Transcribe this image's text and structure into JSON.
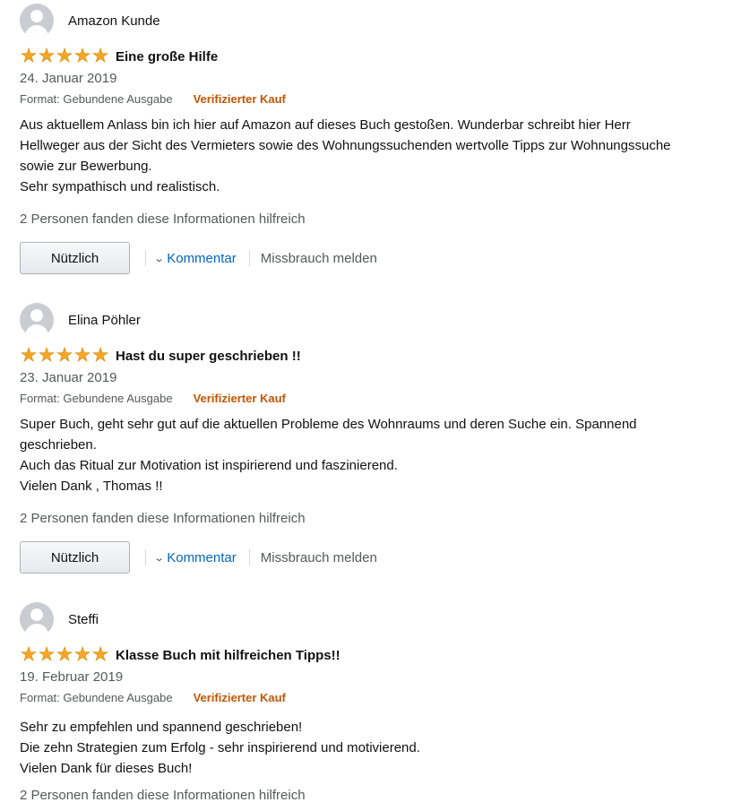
{
  "reviews": [
    {
      "name": "Amazon Kunde",
      "stars": 5,
      "title": "Eine große Hilfe",
      "date": "24. Januar 2019",
      "format": "Format: Gebundene Ausgabe",
      "verified": "Verifizierter Kauf",
      "body": [
        "Aus aktuellem Anlass bin ich hier auf Amazon auf dieses Buch gestoßen. Wunderbar schreibt hier Herr",
        "Hellweger aus der Sicht des Vermieters sowie des Wohnungssuchenden wertvolle Tipps zur Wohnungssuche",
        "sowie zur Bewerbung.",
        "Sehr sympathisch und realistisch."
      ],
      "helpful": "2 Personen fanden diese Informationen hilfreich",
      "useful_label": "Nützlich",
      "comment_label": "Kommentar",
      "report_label": "Missbrauch melden"
    },
    {
      "name": "Elina Pöhler",
      "stars": 5,
      "title": "Hast du super geschrieben !!",
      "date": "23. Januar 2019",
      "format": "Format: Gebundene Ausgabe",
      "verified": "Verifizierter Kauf",
      "body": [
        "Super Buch, geht sehr gut auf die aktuellen Probleme des Wohnraums und deren Suche ein. Spannend",
        "geschrieben.",
        "Auch das Ritual zur Motivation ist inspirierend und faszinierend.",
        "Vielen Dank , Thomas !!"
      ],
      "helpful": "2 Personen fanden diese Informationen hilfreich",
      "useful_label": "Nützlich",
      "comment_label": "Kommentar",
      "report_label": "Missbrauch melden"
    },
    {
      "name": "Steffi",
      "stars": 5,
      "title": "Klasse Buch mit hilfreichen Tipps!!",
      "date": "19. Februar 2019",
      "format": "Format: Gebundene Ausgabe",
      "verified": "Verifizierter Kauf",
      "body": [
        "Sehr zu empfehlen und spannend geschrieben!",
        "Die zehn Strategien zum Erfolg - sehr inspirierend und motivierend.",
        "Vielen Dank für dieses Buch!"
      ],
      "helpful": "2 Personen fanden diese Informationen hilfreich"
    }
  ],
  "colors": {
    "star": "#f6a623",
    "verified": "#c45500",
    "link": "#0066c0"
  },
  "icons": {
    "avatar": "default-user-avatar-icon",
    "star": "filled-star-icon",
    "chevron": "chevron-down-icon"
  }
}
